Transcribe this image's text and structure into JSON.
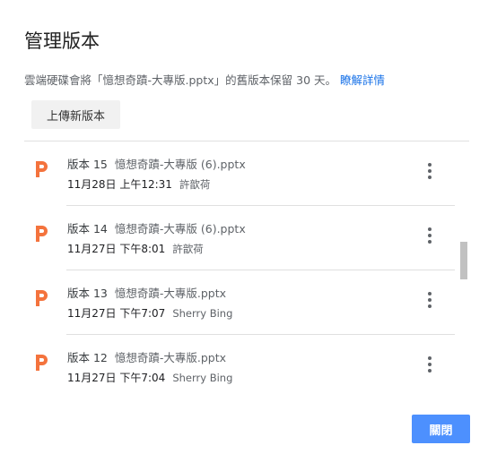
{
  "dialog": {
    "title": "管理版本",
    "description": "雲端硬碟會將「憶想奇蹟-大專版.pptx」的舊版本保留 30 天。",
    "learn_more": "瞭解詳情",
    "upload_label": "上傳新版本",
    "close_label": "關閉"
  },
  "versions": [
    {
      "label": "版本 15",
      "filename": "憶想奇蹟-大專版 (6).pptx",
      "date": "11月28日 上午12:31",
      "author": "許歆荷"
    },
    {
      "label": "版本 14",
      "filename": "憶想奇蹟-大專版 (6).pptx",
      "date": "11月27日 下午8:01",
      "author": "許歆荷"
    },
    {
      "label": "版本 13",
      "filename": "憶想奇蹟-大專版.pptx",
      "date": "11月27日 下午7:07",
      "author": "Sherry Bing"
    },
    {
      "label": "版本 12",
      "filename": "憶想奇蹟-大專版.pptx",
      "date": "11月27日 下午7:04",
      "author": "Sherry Bing"
    }
  ],
  "colors": {
    "accent": "#4d90fe",
    "link": "#1a73e8",
    "file_icon": "#f4733d"
  }
}
